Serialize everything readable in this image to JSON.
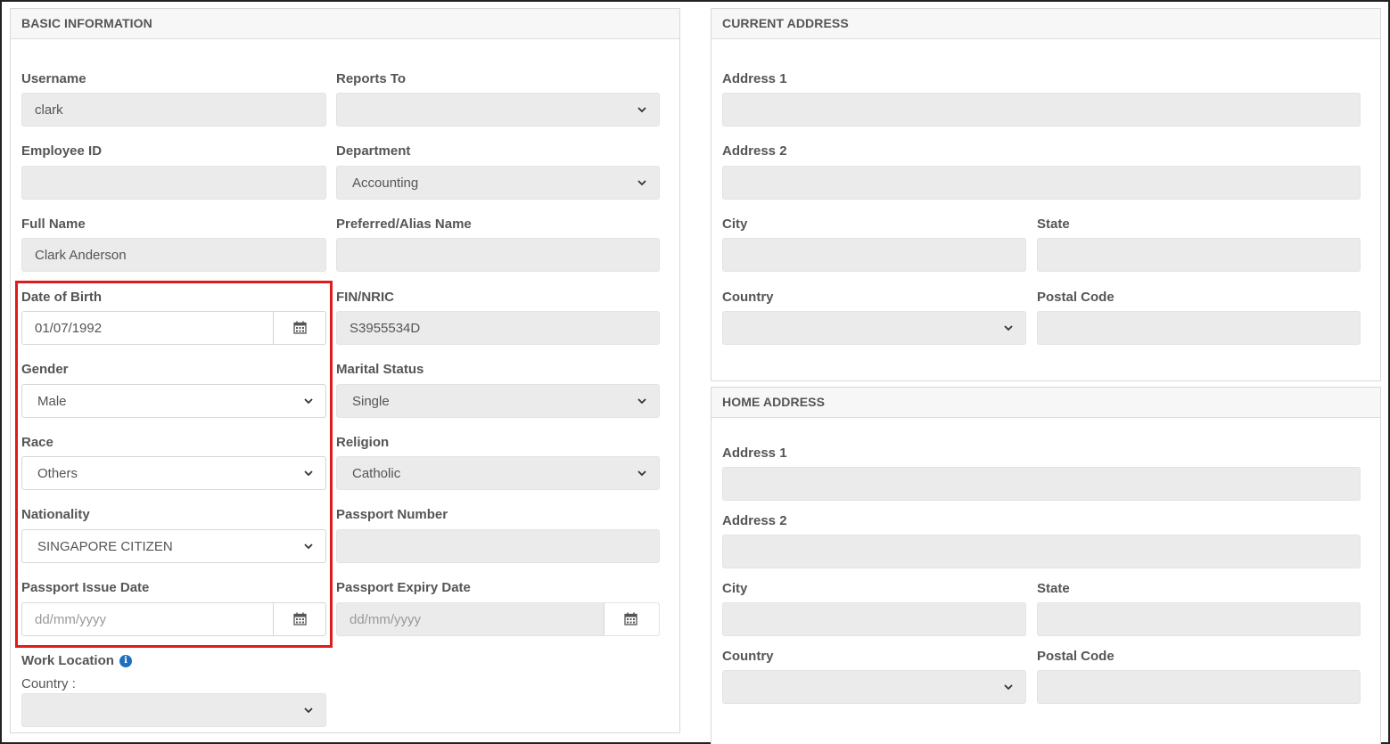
{
  "basic": {
    "title": "BASIC INFORMATION",
    "username": {
      "label": "Username",
      "value": "clark"
    },
    "reports_to": {
      "label": "Reports To",
      "value": ""
    },
    "employee_id": {
      "label": "Employee ID",
      "value": ""
    },
    "department": {
      "label": "Department",
      "value": "Accounting"
    },
    "full_name": {
      "label": "Full Name",
      "value": "Clark Anderson"
    },
    "alias": {
      "label": "Preferred/Alias Name",
      "value": ""
    },
    "dob": {
      "label": "Date of Birth",
      "value": "01/07/1992"
    },
    "fin": {
      "label": "FIN/NRIC",
      "value": "S3955534D"
    },
    "gender": {
      "label": "Gender",
      "value": "Male"
    },
    "marital": {
      "label": "Marital Status",
      "value": "Single"
    },
    "race": {
      "label": "Race",
      "value": "Others"
    },
    "religion": {
      "label": "Religion",
      "value": "Catholic"
    },
    "nationality": {
      "label": "Nationality",
      "value": "SINGAPORE CITIZEN"
    },
    "passport_number": {
      "label": "Passport Number",
      "value": ""
    },
    "passport_issue": {
      "label": "Passport Issue Date",
      "placeholder": "dd/mm/yyyy"
    },
    "passport_expiry": {
      "label": "Passport Expiry Date",
      "placeholder": "dd/mm/yyyy"
    },
    "work_location": {
      "label": "Work Location",
      "country_label": "Country :",
      "value": ""
    }
  },
  "current": {
    "title": "CURRENT ADDRESS",
    "address1": "Address 1",
    "address2": "Address 2",
    "city": "City",
    "state": "State",
    "country": "Country",
    "postal": "Postal Code"
  },
  "home": {
    "title": "HOME ADDRESS",
    "address1": "Address 1",
    "address2": "Address 2",
    "city": "City",
    "state": "State",
    "country": "Country",
    "postal": "Postal Code"
  },
  "icons": {
    "calendar": "calendar-icon",
    "dropdown": "chevron-down-icon",
    "info": "info-icon"
  },
  "colors": {
    "highlight": "#e01b1b",
    "info": "#1f6fbf",
    "field_bg": "#ebebeb"
  }
}
